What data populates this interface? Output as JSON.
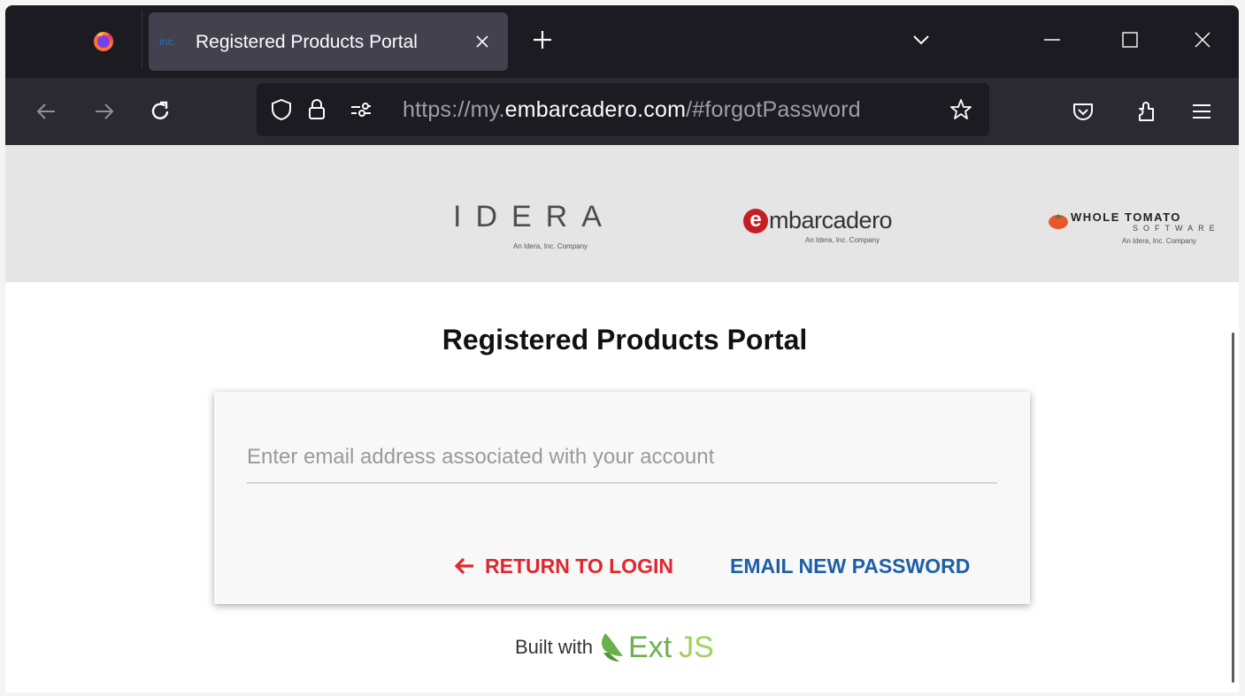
{
  "browser": {
    "tab": {
      "favicon_text": "inc.",
      "title": "Registered Products Portal"
    },
    "url": {
      "prefix": "https://my.",
      "host": "embarcadero.com",
      "path": "/#forgotPassword"
    }
  },
  "brands": {
    "idera": {
      "word": "IDERA",
      "tagline": "An Idera, Inc. Company"
    },
    "embarcadero": {
      "mark": "e",
      "word": "mbarcadero",
      "tagline": "An Idera, Inc. Company"
    },
    "whole_tomato": {
      "line1": "WHOLE TOMATO",
      "line2": "SOFTWARE",
      "tagline": "An Idera, Inc. Company"
    }
  },
  "page": {
    "heading": "Registered Products Portal",
    "email_placeholder": "Enter email address associated with your account",
    "email_value": "",
    "return_label": "RETURN TO LOGIN",
    "email_button_label": "EMAIL NEW PASSWORD",
    "built_with": "Built with",
    "ext": "Ext",
    "js": "JS"
  },
  "colors": {
    "accent_red": "#e3252d",
    "accent_blue": "#1f5fa6",
    "extjs_green": "#6ab04c"
  }
}
